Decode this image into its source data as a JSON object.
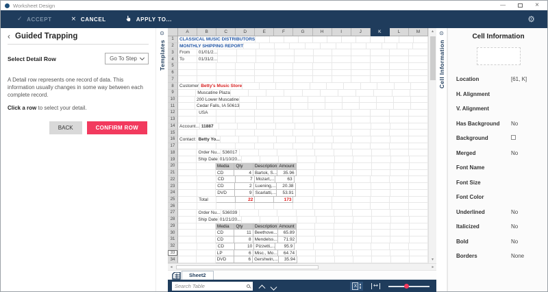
{
  "window": {
    "title": "Worksheet Design"
  },
  "toolbar": {
    "accept": "ACCEPT",
    "cancel": "CANCEL",
    "apply_to": "APPLY TO...",
    "accept_icon": "✓",
    "cancel_icon": "×",
    "gear_icon": "⚙"
  },
  "left_panel": {
    "title": "Guided Trapping",
    "back_chevron": "‹",
    "step_title": "Select Detail Row",
    "goto_label": "Go To Step",
    "description": "A Detail row represents one record of data. This information usually changes in some way between each complete record.",
    "instruction_bold": "Click a row",
    "instruction_rest": " to select your detail.",
    "back_button": "BACK",
    "confirm_button": "CONFIRM ROW"
  },
  "templates_tab": {
    "label": "Templates",
    "pin_icon": "⊙"
  },
  "cell_info_tab": {
    "label": "Cell Information",
    "pin_icon": "⊙"
  },
  "spreadsheet": {
    "columns": [
      "A",
      "B",
      "C",
      "D",
      "E",
      "F",
      "G",
      "H",
      "I",
      "J",
      "K",
      "L",
      "M"
    ],
    "selected_column": "K",
    "row_count": 34,
    "boxed_row": 33,
    "tables": [
      {
        "r1": 20,
        "r2": 25,
        "c1": "C",
        "c2": "F"
      },
      {
        "r1": 29,
        "r2": 34,
        "c1": "C",
        "c2": "F"
      }
    ],
    "cells": [
      {
        "r": 1,
        "c": "A",
        "t": "CLASSICAL MUSIC DISTRIBUTORS",
        "s": "blue"
      },
      {
        "r": 2,
        "c": "A",
        "t": "MONTHLY SHIPPING REPORT",
        "s": "blue"
      },
      {
        "r": 3,
        "c": "A",
        "t": "From"
      },
      {
        "r": 3,
        "c": "B",
        "t": "01/01/2..."
      },
      {
        "r": 4,
        "c": "A",
        "t": "To"
      },
      {
        "r": 4,
        "c": "B",
        "t": "01/31/2..."
      },
      {
        "r": 8,
        "c": "A",
        "t": "Customer"
      },
      {
        "r": 8,
        "c": "B",
        "t": "Betty's Music Store",
        "s": "red-bold"
      },
      {
        "r": 9,
        "c": "B",
        "t": "Muscatine Plaza"
      },
      {
        "r": 10,
        "c": "B",
        "t": "200 Lower Muscatine"
      },
      {
        "r": 11,
        "c": "B",
        "t": "Cedar Falls, IA 50613"
      },
      {
        "r": 12,
        "c": "B",
        "t": "USA"
      },
      {
        "r": 14,
        "c": "A",
        "t": "Account..."
      },
      {
        "r": 14,
        "c": "B",
        "t": "11887",
        "s": "bold"
      },
      {
        "r": 16,
        "c": "A",
        "t": "Contact:"
      },
      {
        "r": 16,
        "c": "B",
        "t": "Betty Yo...",
        "s": "bold"
      },
      {
        "r": 18,
        "c": "B",
        "t": "Order Nu..."
      },
      {
        "r": 18,
        "c": "C",
        "t": "536017"
      },
      {
        "r": 19,
        "c": "B",
        "t": "Ship Date"
      },
      {
        "r": 19,
        "c": "C",
        "t": "01/10/20..."
      },
      {
        "r": 20,
        "c": "C",
        "t": "Media",
        "s": "hdr"
      },
      {
        "r": 20,
        "c": "D",
        "t": "Qty",
        "s": "hdr"
      },
      {
        "r": 20,
        "c": "E",
        "t": "Description",
        "s": "hdr"
      },
      {
        "r": 20,
        "c": "F",
        "t": "Amount",
        "s": "hdr"
      },
      {
        "r": 21,
        "c": "C",
        "t": "CD"
      },
      {
        "r": 21,
        "c": "D",
        "t": "4",
        "s": "num"
      },
      {
        "r": 21,
        "c": "E",
        "t": "Bartok, S..."
      },
      {
        "r": 21,
        "c": "F",
        "t": "35.96",
        "s": "num"
      },
      {
        "r": 22,
        "c": "C",
        "t": "CD"
      },
      {
        "r": 22,
        "c": "D",
        "t": "7",
        "s": "num"
      },
      {
        "r": 22,
        "c": "E",
        "t": "Mozart,..."
      },
      {
        "r": 22,
        "c": "F",
        "t": "63",
        "s": "num"
      },
      {
        "r": 23,
        "c": "C",
        "t": "CD"
      },
      {
        "r": 23,
        "c": "D",
        "t": "2",
        "s": "num"
      },
      {
        "r": 23,
        "c": "E",
        "t": "Luening,..."
      },
      {
        "r": 23,
        "c": "F",
        "t": "20.38",
        "s": "num"
      },
      {
        "r": 24,
        "c": "C",
        "t": "DVD"
      },
      {
        "r": 24,
        "c": "D",
        "t": "9",
        "s": "num"
      },
      {
        "r": 24,
        "c": "E",
        "t": "Scarlatti,..."
      },
      {
        "r": 24,
        "c": "F",
        "t": "53.91",
        "s": "num"
      },
      {
        "r": 25,
        "c": "B",
        "t": "Total"
      },
      {
        "r": 25,
        "c": "D",
        "t": "22",
        "s": "num-red"
      },
      {
        "r": 25,
        "c": "F",
        "t": "173",
        "s": "num-red"
      },
      {
        "r": 27,
        "c": "B",
        "t": "Order Nu..."
      },
      {
        "r": 27,
        "c": "C",
        "t": "536039"
      },
      {
        "r": 28,
        "c": "B",
        "t": "Ship Date"
      },
      {
        "r": 28,
        "c": "C",
        "t": "01/21/20..."
      },
      {
        "r": 29,
        "c": "C",
        "t": "Media",
        "s": "hdr"
      },
      {
        "r": 29,
        "c": "D",
        "t": "Qty",
        "s": "hdr"
      },
      {
        "r": 29,
        "c": "E",
        "t": "Description",
        "s": "hdr"
      },
      {
        "r": 29,
        "c": "F",
        "t": "Amount",
        "s": "hdr"
      },
      {
        "r": 30,
        "c": "C",
        "t": "CD"
      },
      {
        "r": 30,
        "c": "D",
        "t": "11",
        "s": "num"
      },
      {
        "r": 30,
        "c": "E",
        "t": "Beethove..."
      },
      {
        "r": 30,
        "c": "F",
        "t": "65.89",
        "s": "num"
      },
      {
        "r": 31,
        "c": "C",
        "t": "CD"
      },
      {
        "r": 31,
        "c": "D",
        "t": "8",
        "s": "num"
      },
      {
        "r": 31,
        "c": "E",
        "t": "Mendelss..."
      },
      {
        "r": 31,
        "c": "F",
        "t": "71.92",
        "s": "num"
      },
      {
        "r": 32,
        "c": "C",
        "t": "CD"
      },
      {
        "r": 32,
        "c": "D",
        "t": "10",
        "s": "num"
      },
      {
        "r": 32,
        "c": "E",
        "t": "Pizzetti,..."
      },
      {
        "r": 32,
        "c": "F",
        "t": "95.9",
        "s": "num"
      },
      {
        "r": 33,
        "c": "C",
        "t": "LP"
      },
      {
        "r": 33,
        "c": "D",
        "t": "6",
        "s": "num"
      },
      {
        "r": 33,
        "c": "E",
        "t": "Misc., Mo..."
      },
      {
        "r": 33,
        "c": "F",
        "t": "64.74",
        "s": "num"
      },
      {
        "r": 34,
        "c": "C",
        "t": "DVD"
      },
      {
        "r": 34,
        "c": "D",
        "t": "6",
        "s": "num"
      },
      {
        "r": 34,
        "c": "E",
        "t": "Gershwin,..."
      },
      {
        "r": 34,
        "c": "F",
        "t": "35.94",
        "s": "num"
      }
    ]
  },
  "sheet_tabs": {
    "active": "Sheet2"
  },
  "bottom_bar": {
    "search_placeholder": "Search Table"
  },
  "cell_information": {
    "title": "Cell Information",
    "properties": [
      {
        "label": "Location",
        "value": "[61, K]"
      },
      {
        "label": "H. Alignment",
        "value": ""
      },
      {
        "label": "V. Alignment",
        "value": ""
      },
      {
        "label": "Has Background",
        "value": "No"
      },
      {
        "label": "Background",
        "value": "",
        "swatch": true
      },
      {
        "label": "Merged",
        "value": "No"
      },
      {
        "label": "Font Name",
        "value": ""
      },
      {
        "label": "Font Size",
        "value": ""
      },
      {
        "label": "Font Color",
        "value": ""
      },
      {
        "label": "Underlined",
        "value": "No"
      },
      {
        "label": "Italicized",
        "value": "No"
      },
      {
        "label": "Bold",
        "value": "No"
      },
      {
        "label": "Borders",
        "value": "None"
      }
    ]
  },
  "colors": {
    "navy": "#1f3c5c",
    "accent_pink": "#f23a5e",
    "cell_blue": "#2055a4",
    "cell_red": "#d81e1e"
  }
}
